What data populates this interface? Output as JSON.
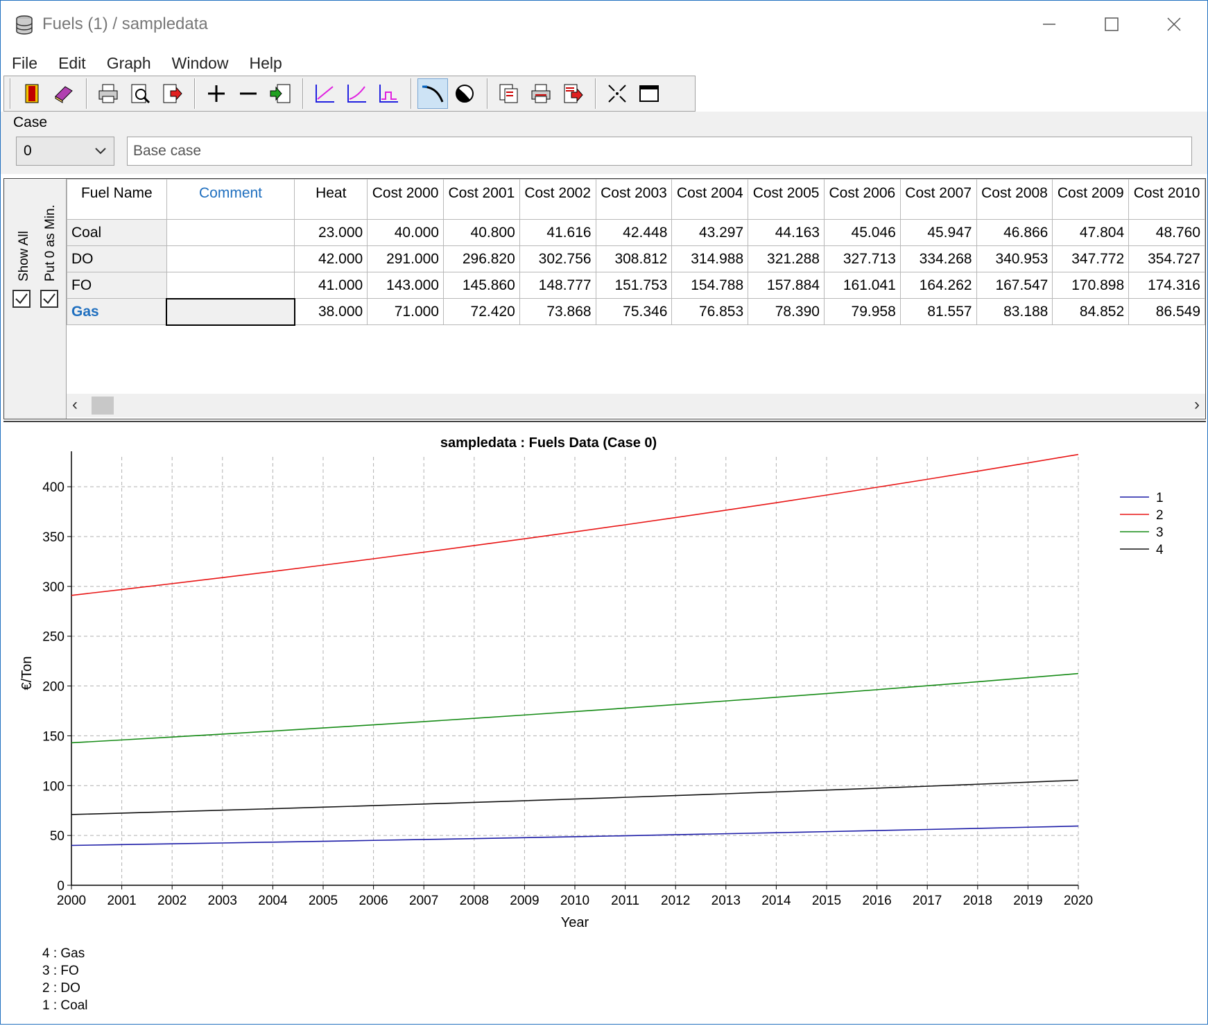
{
  "window": {
    "title": "Fuels (1)  /  sampledata",
    "icon": "database-icon",
    "controls": [
      "minimize-icon",
      "maximize-icon",
      "close-icon"
    ]
  },
  "menu": [
    "File",
    "Edit",
    "Graph",
    "Window",
    "Help"
  ],
  "toolbar": {
    "buttons": [
      "exit-icon",
      "book-icon",
      "print-icon",
      "print-preview-icon",
      "export-icon",
      "add-icon",
      "remove-icon",
      "import-icon",
      "line-chart-icon",
      "line-chart-alt-icon",
      "step-chart-icon",
      "curve-tool-icon",
      "pie-icon",
      "copy-data-icon",
      "print-data-icon",
      "export-data-icon",
      "fit-icon",
      "window-icon"
    ],
    "pressed": "curve-tool-icon"
  },
  "case": {
    "label": "Case",
    "selected": "0",
    "description": "Base case"
  },
  "side_panel": {
    "show_all_label": "Show All",
    "show_all_checked": true,
    "put_zero_label": "Put 0 as Min.",
    "put_zero_checked": true
  },
  "table": {
    "headers": [
      "Fuel Name",
      "Comment",
      "Heat",
      "Cost 2000",
      "Cost 2001",
      "Cost 2002",
      "Cost 2003",
      "Cost 2004",
      "Cost 2005",
      "Cost 2006",
      "Cost 2007",
      "Cost 2008",
      "Cost 2009",
      "Cost 2010"
    ],
    "rows": [
      {
        "name": "Coal",
        "comment": "",
        "values": [
          "23.000",
          "40.000",
          "40.800",
          "41.616",
          "42.448",
          "43.297",
          "44.163",
          "45.046",
          "45.947",
          "46.866",
          "47.804",
          "48.760"
        ]
      },
      {
        "name": "DO",
        "comment": "",
        "values": [
          "42.000",
          "291.000",
          "296.820",
          "302.756",
          "308.812",
          "314.988",
          "321.288",
          "327.713",
          "334.268",
          "340.953",
          "347.772",
          "354.727"
        ]
      },
      {
        "name": "FO",
        "comment": "",
        "values": [
          "41.000",
          "143.000",
          "145.860",
          "148.777",
          "151.753",
          "154.788",
          "157.884",
          "161.041",
          "164.262",
          "167.547",
          "170.898",
          "174.316"
        ]
      },
      {
        "name": "Gas",
        "comment": "",
        "values": [
          "38.000",
          "71.000",
          "72.420",
          "73.868",
          "75.346",
          "76.853",
          "78.390",
          "79.958",
          "81.557",
          "83.188",
          "84.852",
          "86.549"
        ]
      }
    ],
    "selected_row": "Gas"
  },
  "chart_data": {
    "type": "line",
    "title": "sampledata : Fuels Data (Case 0)",
    "xlabel": "Year",
    "ylabel": "€/Ton",
    "x": [
      2000,
      2001,
      2002,
      2003,
      2004,
      2005,
      2006,
      2007,
      2008,
      2009,
      2010,
      2011,
      2012,
      2013,
      2014,
      2015,
      2016,
      2017,
      2018,
      2019,
      2020
    ],
    "xlim": [
      2000,
      2020
    ],
    "ylim": [
      0,
      430
    ],
    "yticks": [
      0,
      50,
      100,
      150,
      200,
      250,
      300,
      350,
      400
    ],
    "grid": true,
    "legend_position": "right",
    "series": [
      {
        "name": "1",
        "color": "#1a1aa6",
        "values": [
          40.0,
          40.8,
          41.616,
          42.448,
          43.297,
          44.163,
          45.046,
          45.947,
          46.866,
          47.804,
          48.76,
          49.735,
          50.73,
          51.744,
          52.779,
          53.835,
          54.911,
          56.01,
          57.13,
          58.272,
          59.438
        ]
      },
      {
        "name": "2",
        "color": "#e81414",
        "values": [
          291.0,
          296.82,
          302.756,
          308.812,
          314.988,
          321.288,
          327.713,
          334.268,
          340.953,
          347.772,
          354.727,
          361.822,
          369.058,
          376.439,
          383.968,
          391.648,
          399.481,
          407.47,
          415.62,
          423.932,
          432.411
        ]
      },
      {
        "name": "3",
        "color": "#148a14",
        "values": [
          143.0,
          145.86,
          148.777,
          151.753,
          154.788,
          157.884,
          161.041,
          164.262,
          167.547,
          170.898,
          174.316,
          177.803,
          181.359,
          184.986,
          188.686,
          192.459,
          196.309,
          200.235,
          204.24,
          208.324,
          212.491
        ]
      },
      {
        "name": "4",
        "color": "#111111",
        "values": [
          71.0,
          72.42,
          73.868,
          75.346,
          76.853,
          78.39,
          79.958,
          81.557,
          83.188,
          84.852,
          86.549,
          88.28,
          90.046,
          91.847,
          93.684,
          95.557,
          97.468,
          99.418,
          101.406,
          103.434,
          105.503
        ]
      }
    ],
    "series_key": [
      "4 : Gas",
      "3 : FO",
      "2 : DO",
      "1 : Coal"
    ]
  }
}
